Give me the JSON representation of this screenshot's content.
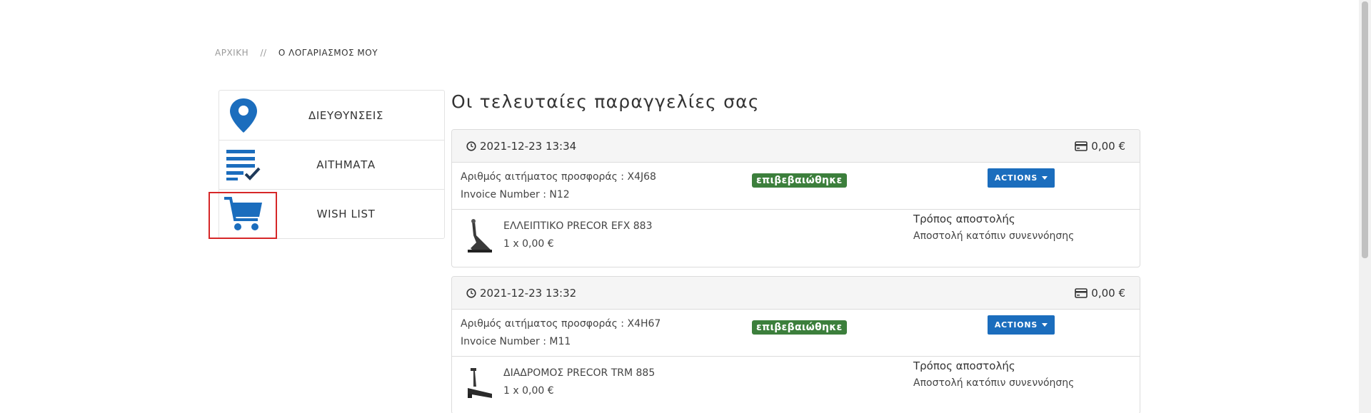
{
  "breadcrumb": {
    "home": "ΑΡΧΙΚΗ",
    "separator": "//",
    "current": "Ο ΛΟΓΑΡΙΑΣΜΟΣ ΜΟΥ"
  },
  "sidebar": {
    "items": [
      {
        "label": "ΔΙΕΥΘΥΝΣΕΙΣ",
        "icon": "map-pin-icon"
      },
      {
        "label": "ΑΙΤΗΜΑΤΑ",
        "icon": "list-check-icon"
      },
      {
        "label": "WISH LIST",
        "icon": "cart-icon"
      }
    ]
  },
  "colors": {
    "accent": "#1b6dbd",
    "badge": "#3c7f3c",
    "highlight": "#d62728"
  },
  "main": {
    "title": "Οι τελευταίες παραγγελίες σας",
    "orders": [
      {
        "date": "2021-12-23 13:34",
        "total": "0,00 €",
        "request_number": "Αριθμός αιτήματος προσφοράς : Χ4J68",
        "invoice_number": "Invoice Number : Ν12",
        "status": "επιβεβαιώθηκε",
        "actions_label": "ACTIONS",
        "product_name": "ΕΛΛΕΙΠΤΙΚΟ PRECOR EFX 883",
        "product_qty": "1 x 0,00 €",
        "shipping_label": "Τρόπος αποστολής",
        "shipping_value": "Αποστολή κατόπιν συνεννόησης"
      },
      {
        "date": "2021-12-23 13:32",
        "total": "0,00 €",
        "request_number": "Αριθμός αιτήματος προσφοράς : Χ4Η67",
        "invoice_number": "Invoice Number : Μ11",
        "status": "επιβεβαιώθηκε",
        "actions_label": "ACTIONS",
        "product_name": "ΔΙΑΔΡΟΜΟΣ PRECOR TRM 885",
        "product_qty": "1 x 0,00 €",
        "shipping_label": "Τρόπος αποστολής",
        "shipping_value": "Αποστολή κατόπιν συνεννόησης"
      }
    ]
  }
}
